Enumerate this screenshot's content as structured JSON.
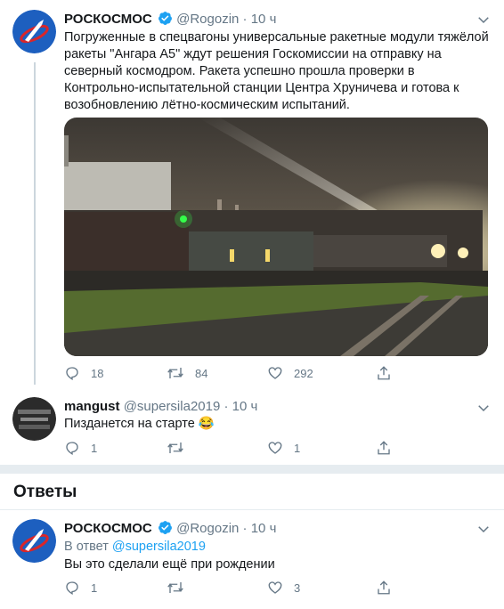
{
  "main_tweet": {
    "name": "РОСКОСМОС",
    "handle": "@Rogozin",
    "dot": "·",
    "time": "10 ч",
    "text": "Погруженные в спецвагоны универсальные ракетные модули тяжёлой ракеты \"Ангара А5\" ждут решения Госкомиссии на отправку на северный космодром. Ракета  успешно прошла проверки в Контрольно-испытательной станции Центра Хруничева и готова к возобновлению лётно-космическим испытаний.",
    "replies": "18",
    "retweets": "84",
    "likes": "292"
  },
  "reply_tweet": {
    "name": "mangust",
    "handle": "@supersila2019",
    "dot": "·",
    "time": "10 ч",
    "text": "Пизданется на старте 😂",
    "replies": "1",
    "likes": "1"
  },
  "answers_section": {
    "title": "Ответы"
  },
  "answer_tweet": {
    "name": "РОСКОСМОС",
    "handle": "@Rogozin",
    "dot": "·",
    "time": "10 ч",
    "reply_to_prefix": "В ответ",
    "reply_to_handle": "@supersila2019",
    "text": "Вы это сделали ещё при рождении",
    "replies": "1",
    "likes": "3"
  },
  "colors": {
    "accent": "#1da1f2",
    "secondary_text": "#657786",
    "separator": "#e6ecf0"
  },
  "icons": [
    "roscosmos-logo",
    "verified-badge",
    "chevron-down-icon",
    "reply-icon",
    "retweet-icon",
    "like-icon",
    "share-icon"
  ]
}
